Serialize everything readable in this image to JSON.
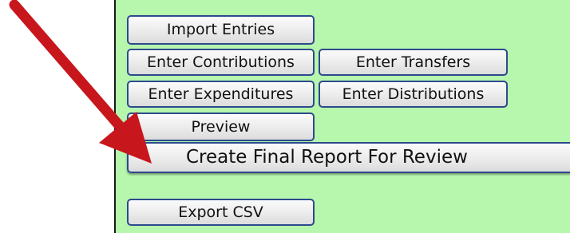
{
  "buttons": {
    "import_entries": "Import Entries",
    "enter_contributions": "Enter Contributions",
    "enter_transfers": "Enter Transfers",
    "enter_expenditures": "Enter Expenditures",
    "enter_distributions": "Enter Distributions",
    "preview": "Preview",
    "create_final_report": "Create Final Report For Review",
    "export_csv": "Export CSV"
  },
  "colors": {
    "panel_background": "#b6f6ad",
    "button_border": "#2c4a8c",
    "arrow": "#c8161d"
  }
}
